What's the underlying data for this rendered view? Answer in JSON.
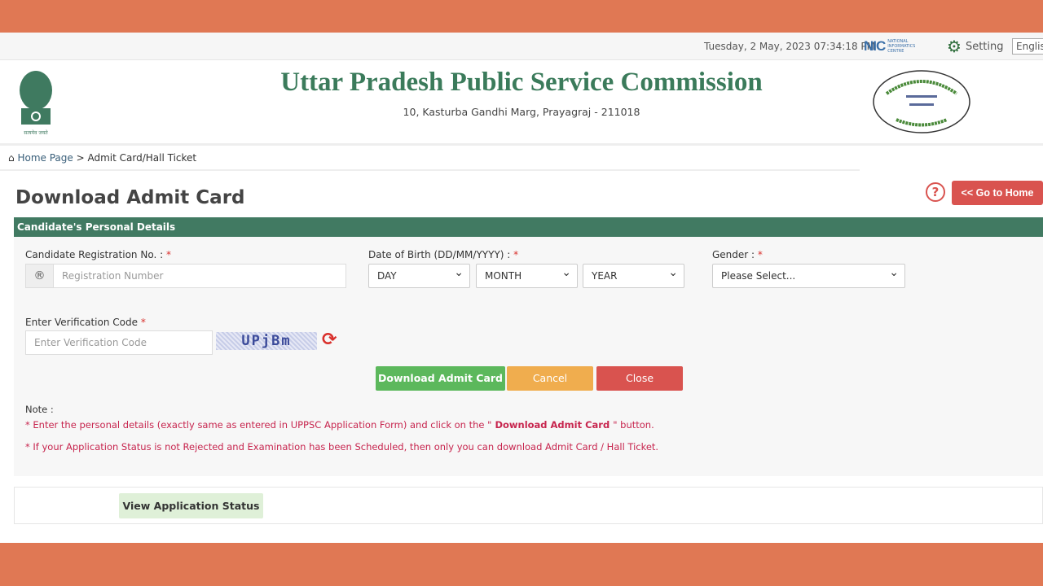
{
  "topbar": {
    "datetime": "Tuesday, 2 May, 2023 07:34:18 PM",
    "nic_logo": "NIC",
    "nic_text": "NATIONAL INFORMATICS CENTRE",
    "setting_label": "Setting",
    "language": "English"
  },
  "header": {
    "title": "Uttar Pradesh Public Service Commission",
    "address": "10, Kasturba Gandhi Marg, Prayagraj - 211018",
    "emblem_text": "सत्यमेव जयते"
  },
  "breadcrumb": {
    "home": "Home Page",
    "separator": ">",
    "current": "Admit Card/Hall Ticket"
  },
  "page": {
    "title": "Download Admit Card",
    "help": "?",
    "go_home": "<< Go to Home"
  },
  "form": {
    "section_title": "Candidate's Personal Details",
    "reg_label": "Candidate Registration No. :",
    "reg_icon": "®",
    "reg_placeholder": "Registration Number",
    "dob_label": "Date of Birth (DD/MM/YYYY) :",
    "day": "DAY",
    "month": "MONTH",
    "year": "YEAR",
    "gender_label": "Gender :",
    "gender_value": "Please Select...",
    "code_label": "Enter Verification Code",
    "code_placeholder": "Enter Verification Code",
    "captcha": "UPjBm",
    "required": "*"
  },
  "buttons": {
    "download": "Download Admit Card",
    "cancel": "Cancel",
    "close": "Close",
    "view_status": "View Application Status"
  },
  "notes": {
    "heading": "Note :",
    "line1_a": "* Enter the personal details (exactly same as entered in UPPSC Application Form) and click on the \"",
    "line1_b": " Download Admit Card ",
    "line1_c": "\" button.",
    "line2": "* If your Application Status is not Rejected and Examination has been Scheduled, then only you can download Admit Card / Hall Ticket."
  },
  "colors": {
    "brand_green": "#417a62",
    "danger": "#d9534f",
    "success": "#5cb85c",
    "warning": "#f0ad4e",
    "frame": "#e07854"
  }
}
